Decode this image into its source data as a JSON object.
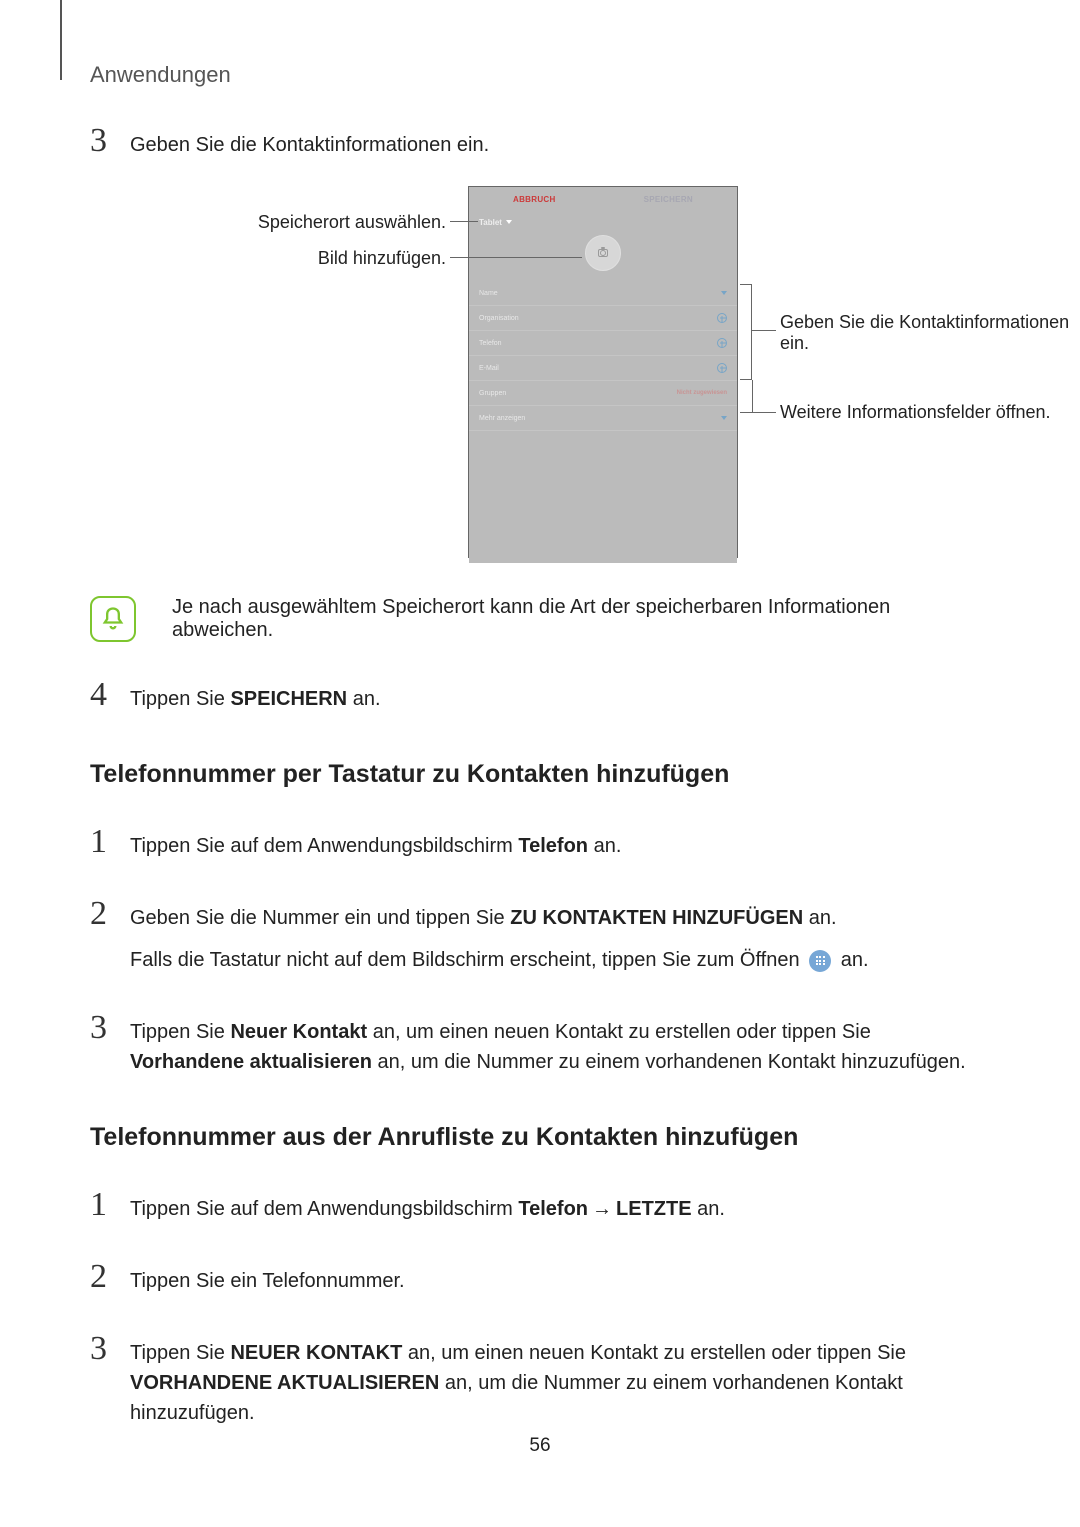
{
  "header": "Anwendungen",
  "page_number": "56",
  "step_a": {
    "num": "3",
    "text": "Geben Sie die Kontaktinformationen ein."
  },
  "figure": {
    "phone": {
      "top_left": "ABBRUCH",
      "top_right": "SPEICHERN",
      "storage_label": "Tablet",
      "fields": {
        "name": "Name",
        "org": "Organisation",
        "phone": "Telefon",
        "email": "E-Mail",
        "groups": "Gruppen",
        "groups_right": "Nicht zugewiesen",
        "more": "Mehr anzeigen"
      }
    },
    "callouts": {
      "left1": "Speicherort auswählen.",
      "left2": "Bild hinzufügen.",
      "right1": "Geben Sie die Kontaktinformationen ein.",
      "right2": "Weitere Informationsfelder öffnen."
    }
  },
  "note": "Je nach ausgewähltem Speicherort kann die Art der speicherbaren Informationen abweichen.",
  "step_b": {
    "num": "4",
    "pre": "Tippen Sie ",
    "bold": "SPEICHERN",
    "post": " an."
  },
  "heading1": "Telefonnummer per Tastatur zu Kontakten hinzufügen",
  "h1_steps": {
    "s1": {
      "num": "1",
      "pre": "Tippen Sie auf dem Anwendungsbildschirm ",
      "bold": "Telefon",
      "post": " an."
    },
    "s2": {
      "num": "2",
      "line1_pre": "Geben Sie die Nummer ein und tippen Sie ",
      "line1_bold": "ZU KONTAKTEN HINZUFÜGEN",
      "line1_post": " an.",
      "line2_pre": "Falls die Tastatur nicht auf dem Bildschirm erscheint, tippen Sie zum Öffnen ",
      "line2_post": " an."
    },
    "s3": {
      "num": "3",
      "pre": "Tippen Sie ",
      "bold1": "Neuer Kontakt",
      "mid": " an, um einen neuen Kontakt zu erstellen oder tippen Sie ",
      "bold2": "Vorhandene aktualisieren",
      "post": " an, um die Nummer zu einem vorhandenen Kontakt hinzuzufügen."
    }
  },
  "heading2": "Telefonnummer aus der Anrufliste zu Kontakten hinzufügen",
  "h2_steps": {
    "s1": {
      "num": "1",
      "pre": "Tippen Sie auf dem Anwendungsbildschirm ",
      "bold1": "Telefon",
      "arrow": "→",
      "bold2": "LETZTE",
      "post": " an."
    },
    "s2": {
      "num": "2",
      "text": "Tippen Sie ein Telefonnummer."
    },
    "s3": {
      "num": "3",
      "pre": "Tippen Sie ",
      "bold1": "NEUER KONTAKT",
      "mid": " an, um einen neuen Kontakt zu erstellen oder tippen Sie ",
      "bold2": "VORHANDENE AKTUALISIEREN",
      "post": " an, um die Nummer zu einem vorhandenen Kontakt hinzuzufügen."
    }
  }
}
